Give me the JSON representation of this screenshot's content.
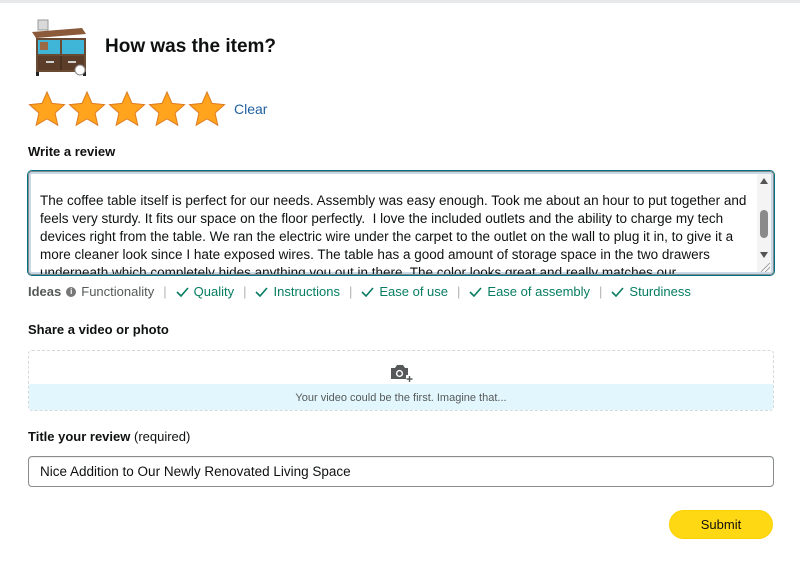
{
  "page": {
    "title": "How was the item?"
  },
  "rating": {
    "stars_filled": 5,
    "stars_total": 5,
    "star_color": "#ffa41c",
    "clear_label": "Clear"
  },
  "review": {
    "label": "Write a review",
    "text": "The coffee table itself is perfect for our needs. Assembly was easy enough. Took me about an hour to put together and feels very sturdy. It fits our space on the floor perfectly.  I love the included outlets and the ability to charge my tech devices right from the table. We ran the electric wire under the carpet to the outlet on the wall to plug it in, to give it a more cleaner look since I hate exposed wires. The table has a good amount of storage space in the two drawers underneath which completely hides anything you out in there. The color looks great and really matches our"
  },
  "ideas": {
    "title": "Ideas",
    "info_icon": "info-icon",
    "items": [
      {
        "label": "Functionality",
        "done": false
      },
      {
        "label": "Quality",
        "done": true
      },
      {
        "label": "Instructions",
        "done": true
      },
      {
        "label": "Ease of use",
        "done": true
      },
      {
        "label": "Ease of assembly",
        "done": true
      },
      {
        "label": "Sturdiness",
        "done": true
      }
    ],
    "done_color": "#067d62"
  },
  "media": {
    "label": "Share a video or photo",
    "prompt": "Your video could be the first. Imagine that...",
    "icon": "camera-plus-icon"
  },
  "review_title": {
    "label": "Title your review",
    "required_note": "(required)",
    "value": "Nice Addition to Our Newly Renovated Living Space"
  },
  "actions": {
    "submit_label": "Submit",
    "submit_color": "#ffd814"
  }
}
